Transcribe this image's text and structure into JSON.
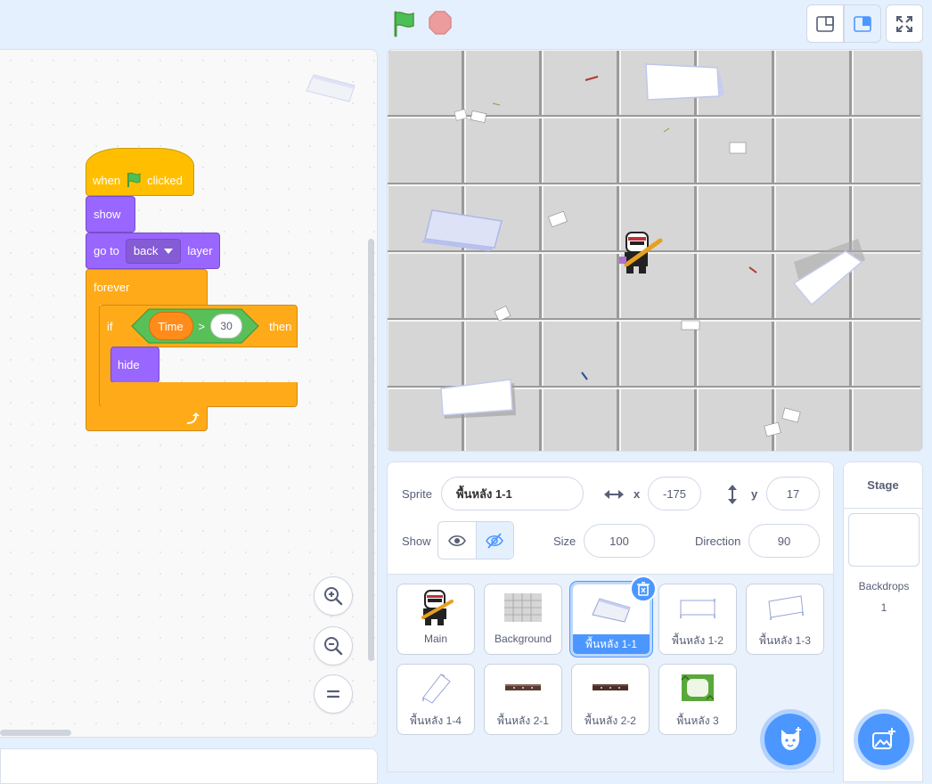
{
  "controls": {
    "green_flag": "green-flag-icon",
    "stop": "stop-sign-icon",
    "small_stage": "small-stage-icon",
    "large_stage": "large-stage-icon",
    "fullscreen": "fullscreen-icon"
  },
  "script": {
    "when": "when",
    "clicked": "clicked",
    "show": "show",
    "go_to": "go to",
    "layer_option": "back",
    "layer": "layer",
    "forever": "forever",
    "if": "if",
    "variable": "Time",
    "operator": ">",
    "value": "30",
    "then": "then",
    "hide": "hide"
  },
  "sprite_info": {
    "sprite_label": "Sprite",
    "sprite_name": "พื้นหลัง 1-1",
    "x_label": "x",
    "x_value": "-175",
    "y_label": "y",
    "y_value": "17",
    "show_label": "Show",
    "size_label": "Size",
    "size_value": "100",
    "direction_label": "Direction",
    "direction_value": "90"
  },
  "sprites": [
    {
      "name": "Main"
    },
    {
      "name": "Background"
    },
    {
      "name": "พื้นหลัง 1-1",
      "selected": true
    },
    {
      "name": "พื้นหลัง 1-2"
    },
    {
      "name": "พื้นหลัง 1-3"
    },
    {
      "name": "พื้นหลัง 1-4"
    },
    {
      "name": "พื้นหลัง 2-1"
    },
    {
      "name": "พื้นหลัง 2-2"
    },
    {
      "name": "พื้นหลัง 3"
    }
  ],
  "stage_panel": {
    "title": "Stage",
    "backdrops_label": "Backdrops",
    "backdrops_count": "1"
  },
  "colors": {
    "accent": "#4c97ff",
    "events": "#ffbf00",
    "looks": "#9966ff",
    "control": "#ffab19",
    "operators": "#59c059",
    "variables": "#ff8c1a"
  }
}
